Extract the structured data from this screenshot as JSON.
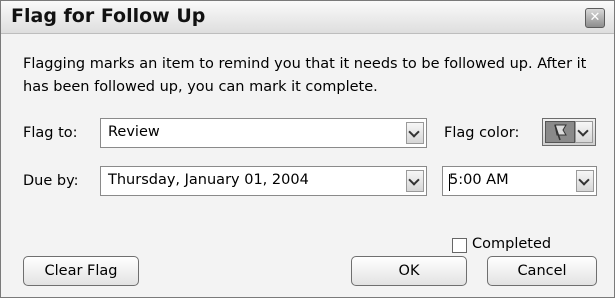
{
  "dialog": {
    "title": "Flag for Follow Up",
    "close_icon": "close-icon",
    "description": "Flagging marks an item to remind you that it needs to be followed up.  After it has been followed up, you can mark it complete."
  },
  "flag_to": {
    "label": "Flag to:",
    "value": "Review"
  },
  "flag_color": {
    "label": "Flag color:",
    "icon": "flag-icon"
  },
  "due_by": {
    "label": "Due by:",
    "date_value": "Thursday, January 01, 2004",
    "time_value": "5:00 AM"
  },
  "completed": {
    "label": "Completed",
    "checked": false
  },
  "buttons": {
    "clear_flag": "Clear Flag",
    "ok": "OK",
    "cancel": "Cancel"
  }
}
